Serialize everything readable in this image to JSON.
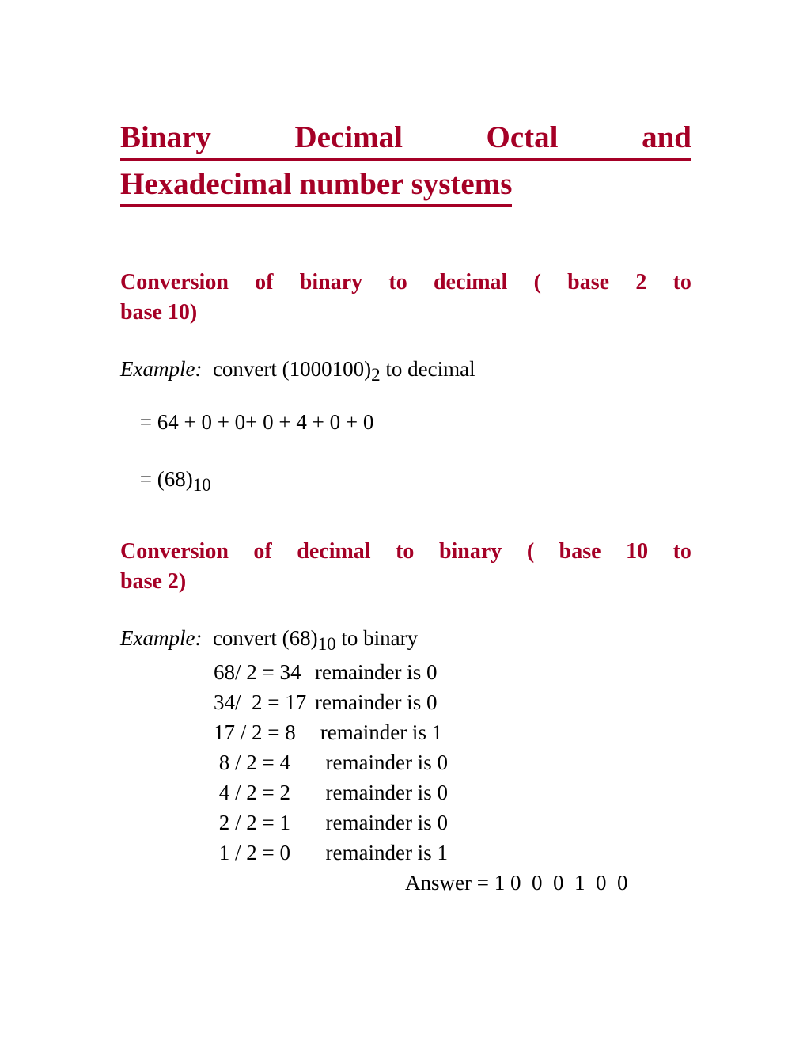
{
  "document": {
    "title": {
      "line1_words": [
        "Binary",
        "Decimal",
        "Octal",
        "and"
      ],
      "line2": "Hexadecimal number systems",
      "color": "#A50026",
      "underlined": true
    },
    "sections": [
      {
        "heading_line1_words": [
          "Conversion",
          "of",
          "binary",
          "to",
          "decimal",
          "(",
          "base",
          "2",
          "to"
        ],
        "heading_line2": "base 10)",
        "heading_color": "#A50026",
        "example": {
          "label": "Example:",
          "text_before": "  convert (1000100)",
          "subscript": "2",
          "text_after": " to decimal"
        },
        "equations": [
          " = 64 + 0 + 0+ 0 + 4 + 0 + 0",
          " = (68)"
        ],
        "equation_2_subscript": "10"
      },
      {
        "heading_line1_words": [
          "Conversion",
          "of",
          "decimal",
          "to",
          "binary",
          "(",
          "base",
          "10",
          "to"
        ],
        "heading_line2": "base 2)",
        "heading_color": "#A50026",
        "example": {
          "label": "Example:",
          "text_before": "  convert (68)",
          "subscript": "10",
          "text_after": " to binary"
        },
        "divisions": [
          {
            "lhs": "68/ 2 = 34",
            "rhs": "remainder is 0"
          },
          {
            "lhs": "34/  2 = 17",
            "rhs": "remainder is 0"
          },
          {
            "lhs": "17 / 2 = 8",
            "rhs": " remainder is 1"
          },
          {
            "lhs": " 8 / 2 = 4",
            "rhs": "  remainder is 0"
          },
          {
            "lhs": " 4 / 2 = 2",
            "rhs": "  remainder is 0"
          },
          {
            "lhs": " 2 / 2 = 1",
            "rhs": "  remainder is 0"
          },
          {
            "lhs": " 1 / 2 = 0",
            "rhs": "  remainder is 1"
          }
        ],
        "answer": "Answer = 1 0  0  0  1  0  0"
      }
    ]
  }
}
